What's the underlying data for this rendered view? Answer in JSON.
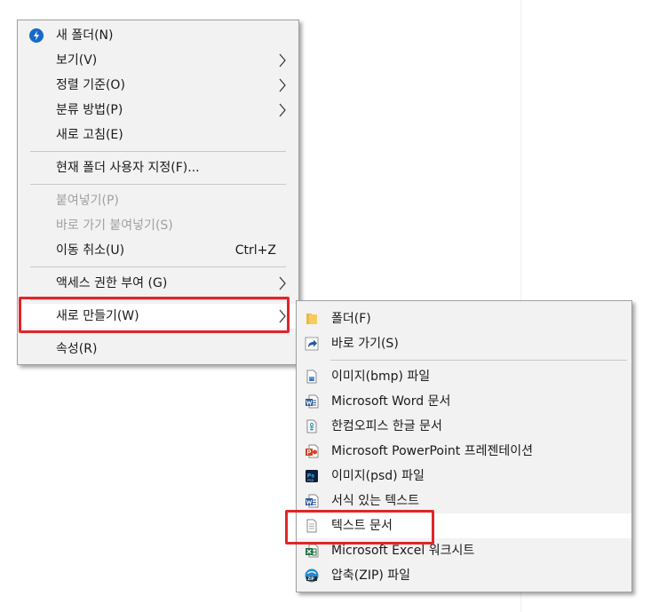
{
  "main_menu": {
    "items": [
      {
        "label": "새 폴더(N)"
      },
      {
        "label": "보기(V)"
      },
      {
        "label": "정렬 기준(O)"
      },
      {
        "label": "분류 방법(P)"
      },
      {
        "label": "새로 고침(E)"
      },
      {
        "label": "현재 폴더 사용자 지정(F)..."
      },
      {
        "label": "붙여넣기(P)"
      },
      {
        "label": "바로 가기 붙여넣기(S)"
      },
      {
        "label": "이동 취소(U)",
        "shortcut": "Ctrl+Z"
      },
      {
        "label": "액세스 권한 부여 (G)"
      },
      {
        "label": "새로 만들기(W)"
      },
      {
        "label": "속성(R)"
      }
    ]
  },
  "sub_menu": {
    "items": [
      {
        "label": "폴더(F)",
        "icon": "folder-icon"
      },
      {
        "label": "바로 가기(S)",
        "icon": "shortcut-icon"
      },
      {
        "label": "이미지(bmp) 파일",
        "icon": "bitmap-image-icon"
      },
      {
        "label": "Microsoft Word 문서",
        "icon": "word-document-icon"
      },
      {
        "label": "한컴오피스 한글 문서",
        "icon": "hwp-document-icon"
      },
      {
        "label": "Microsoft PowerPoint 프레젠테이션",
        "icon": "powerpoint-icon"
      },
      {
        "label": "이미지(psd) 파일",
        "icon": "photoshop-icon"
      },
      {
        "label": "서식 있는 텍스트",
        "icon": "rich-text-icon"
      },
      {
        "label": "텍스트 문서",
        "icon": "text-document-icon"
      },
      {
        "label": "Microsoft Excel 워크시트",
        "icon": "excel-icon"
      },
      {
        "label": "압축(ZIP) 파일",
        "icon": "zip-archive-icon"
      }
    ]
  },
  "colors": {
    "highlight_border": "#e0252b",
    "menu_background": "#f2f2f2",
    "disabled_text": "#a0a0a0"
  }
}
